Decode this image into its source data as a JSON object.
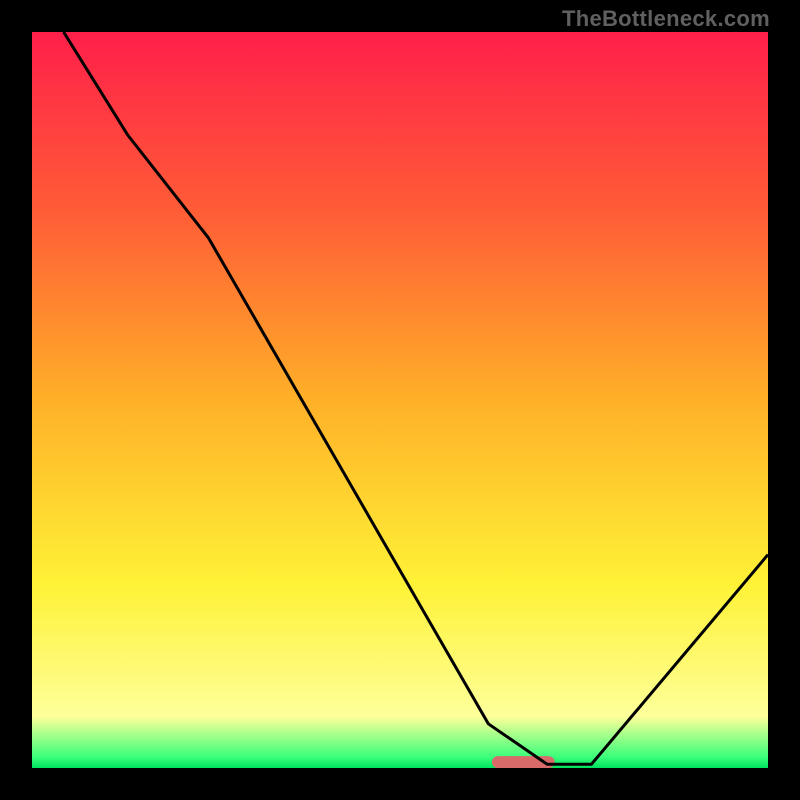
{
  "branding": "TheBottleneck.com",
  "chart_data": {
    "type": "line",
    "title": "",
    "xlabel": "",
    "ylabel": "",
    "xlim": [
      0,
      100
    ],
    "ylim": [
      0,
      100
    ],
    "grid": false,
    "legend": false,
    "series": [
      {
        "name": "curve",
        "x": [
          4.3,
          13.0,
          24.0,
          62.0,
          70.0,
          76.0,
          100.0
        ],
        "y": [
          100.0,
          86.0,
          72.0,
          6.0,
          0.5,
          0.5,
          29.0
        ]
      }
    ],
    "gradient_stops": [
      {
        "pos": 0.0,
        "color": "#ff1f4a"
      },
      {
        "pos": 0.25,
        "color": "#ff5e36"
      },
      {
        "pos": 0.5,
        "color": "#ffb028"
      },
      {
        "pos": 0.75,
        "color": "#fff236"
      },
      {
        "pos": 0.93,
        "color": "#fdff9a"
      },
      {
        "pos": 0.985,
        "color": "#3bff7a"
      },
      {
        "pos": 1.0,
        "color": "#00e060"
      }
    ],
    "marker": {
      "x_start": 62.5,
      "x_end": 71.0,
      "y": 0.8,
      "color": "#d96a6a"
    }
  }
}
